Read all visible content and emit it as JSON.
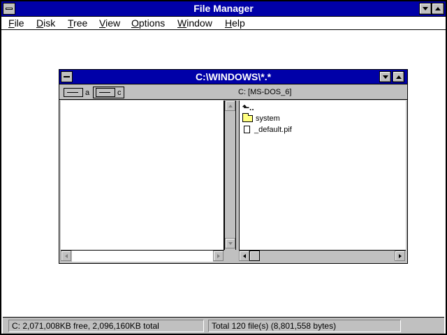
{
  "app": {
    "title": "File Manager"
  },
  "menu": {
    "file": {
      "hot": "F",
      "rest": "ile"
    },
    "disk": {
      "hot": "D",
      "rest": "isk"
    },
    "tree": {
      "hot": "T",
      "rest": "ree"
    },
    "view": {
      "hot": "V",
      "rest": "iew"
    },
    "options": {
      "hot": "O",
      "rest": "ptions"
    },
    "window": {
      "hot": "W",
      "rest": "indow"
    },
    "help": {
      "hot": "H",
      "rest": "elp"
    }
  },
  "child": {
    "title": "C:\\WINDOWS\\*.*",
    "drives": [
      {
        "letter": "a",
        "selected": false
      },
      {
        "letter": "c",
        "selected": true
      }
    ],
    "volume_label": "C: [MS-DOS_6]",
    "files": [
      {
        "name": "",
        "icon": "up-arrow-icon"
      },
      {
        "name": "system",
        "icon": "folder-icon"
      },
      {
        "name": "_default.pif",
        "icon": "document-icon"
      }
    ],
    "up_glyph": "⬑.."
  },
  "status": {
    "disk_free": "C: 2,071,008KB free,  2,096,160KB total",
    "file_total": "Total 120 file(s) (8,801,558 bytes)"
  },
  "colors": {
    "titlebar": "#0000a8",
    "chrome": "#c0c0c0",
    "folder": "#ffff80"
  }
}
